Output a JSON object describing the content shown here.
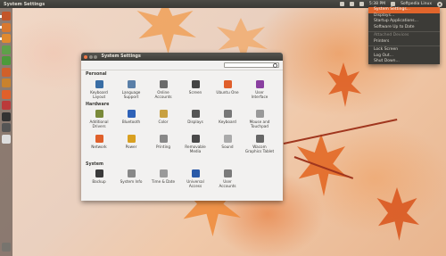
{
  "top_panel": {
    "app_title": "System Settings",
    "clock": "5:38 PM",
    "user": "Softpedia Linux"
  },
  "settings_menu": {
    "items": [
      {
        "label": "System Settings...",
        "state": "active"
      },
      {
        "label": "Displays...",
        "state": "normal"
      },
      {
        "label": "Startup Applications...",
        "state": "normal"
      },
      {
        "label": "Software Up to Date",
        "state": "normal"
      },
      {
        "label": "Attached Devices",
        "state": "disabled"
      },
      {
        "label": "Printers",
        "state": "normal"
      },
      {
        "label": "Lock Screen",
        "state": "normal"
      },
      {
        "label": "Log Out...",
        "state": "normal"
      },
      {
        "label": "Shut Down...",
        "state": "normal"
      }
    ]
  },
  "window": {
    "title": "System Settings",
    "search_placeholder": "",
    "sections": {
      "personal": "Personal",
      "hardware": "Hardware",
      "system": "System"
    },
    "personal_items": [
      {
        "l1": "Keyboard",
        "l2": "Layout",
        "color": "#3a6ea5",
        "icon": "keyboard-layout-icon"
      },
      {
        "l1": "Language",
        "l2": "Support",
        "color": "#5a7fa8",
        "icon": "language-icon"
      },
      {
        "l1": "Online",
        "l2": "Accounts",
        "color": "#6b6b6b",
        "icon": "online-accounts-icon"
      },
      {
        "l1": "Screen",
        "l2": "",
        "color": "#444444",
        "icon": "screen-icon"
      },
      {
        "l1": "Ubuntu One",
        "l2": "",
        "color": "#e05e2a",
        "icon": "ubuntu-one-icon"
      },
      {
        "l1": "User",
        "l2": "Interface",
        "color": "#8a3fa0",
        "icon": "user-interface-icon"
      }
    ],
    "hardware_items": [
      {
        "l1": "Additional",
        "l2": "Drivers",
        "color": "#7a8a3a",
        "icon": "drivers-icon"
      },
      {
        "l1": "Bluetooth",
        "l2": "",
        "color": "#2f62b8",
        "icon": "bluetooth-icon"
      },
      {
        "l1": "Color",
        "l2": "",
        "color": "#c8a040",
        "icon": "color-icon"
      },
      {
        "l1": "Displays",
        "l2": "",
        "color": "#555555",
        "icon": "displays-icon"
      },
      {
        "l1": "Keyboard",
        "l2": "",
        "color": "#777777",
        "icon": "keyboard-icon"
      },
      {
        "l1": "Mouse and",
        "l2": "Touchpad",
        "color": "#999999",
        "icon": "mouse-icon"
      },
      {
        "l1": "Network",
        "l2": "",
        "color": "#e0602a",
        "icon": "network-icon"
      },
      {
        "l1": "Power",
        "l2": "",
        "color": "#d9a020",
        "icon": "power-icon"
      },
      {
        "l1": "Printing",
        "l2": "",
        "color": "#888888",
        "icon": "printer-icon"
      },
      {
        "l1": "Removable",
        "l2": "Media",
        "color": "#4a4a4a",
        "icon": "removable-media-icon"
      },
      {
        "l1": "Sound",
        "l2": "",
        "color": "#aaaaaa",
        "icon": "sound-icon"
      },
      {
        "l1": "Wacom",
        "l2": "Graphics Tablet",
        "color": "#666666",
        "icon": "wacom-icon"
      }
    ],
    "system_items": [
      {
        "l1": "Backup",
        "l2": "",
        "color": "#3a3a3a",
        "icon": "backup-icon"
      },
      {
        "l1": "System Info",
        "l2": "",
        "color": "#888888",
        "icon": "system-info-icon"
      },
      {
        "l1": "Time & Date",
        "l2": "",
        "color": "#9a9a9a",
        "icon": "clock-icon"
      },
      {
        "l1": "Universal",
        "l2": "Access",
        "color": "#2a5aa8",
        "icon": "accessibility-icon"
      },
      {
        "l1": "User",
        "l2": "Accounts",
        "color": "#7a7a7a",
        "icon": "user-accounts-icon"
      }
    ]
  },
  "launcher_items": [
    {
      "icon": "dash-icon",
      "color": "#c3562a"
    },
    {
      "icon": "files-icon",
      "color": "#d9782e"
    },
    {
      "icon": "firefox-icon",
      "color": "#e08a2e"
    },
    {
      "icon": "writer-icon",
      "color": "#5fa04a"
    },
    {
      "icon": "calc-icon",
      "color": "#4c9a3a"
    },
    {
      "icon": "impress-icon",
      "color": "#d0602a"
    },
    {
      "icon": "software-center-icon",
      "color": "#c9822e"
    },
    {
      "icon": "ubuntu-one-icon",
      "color": "#e0602a"
    },
    {
      "icon": "settings-icon",
      "color": "#bb3a3a"
    },
    {
      "icon": "terminal-icon",
      "color": "#333333"
    },
    {
      "icon": "workspaces-icon",
      "color": "#555555"
    },
    {
      "icon": "disk-icon",
      "color": "#dddddd"
    }
  ],
  "launcher_trash": {
    "icon": "trash-icon"
  }
}
